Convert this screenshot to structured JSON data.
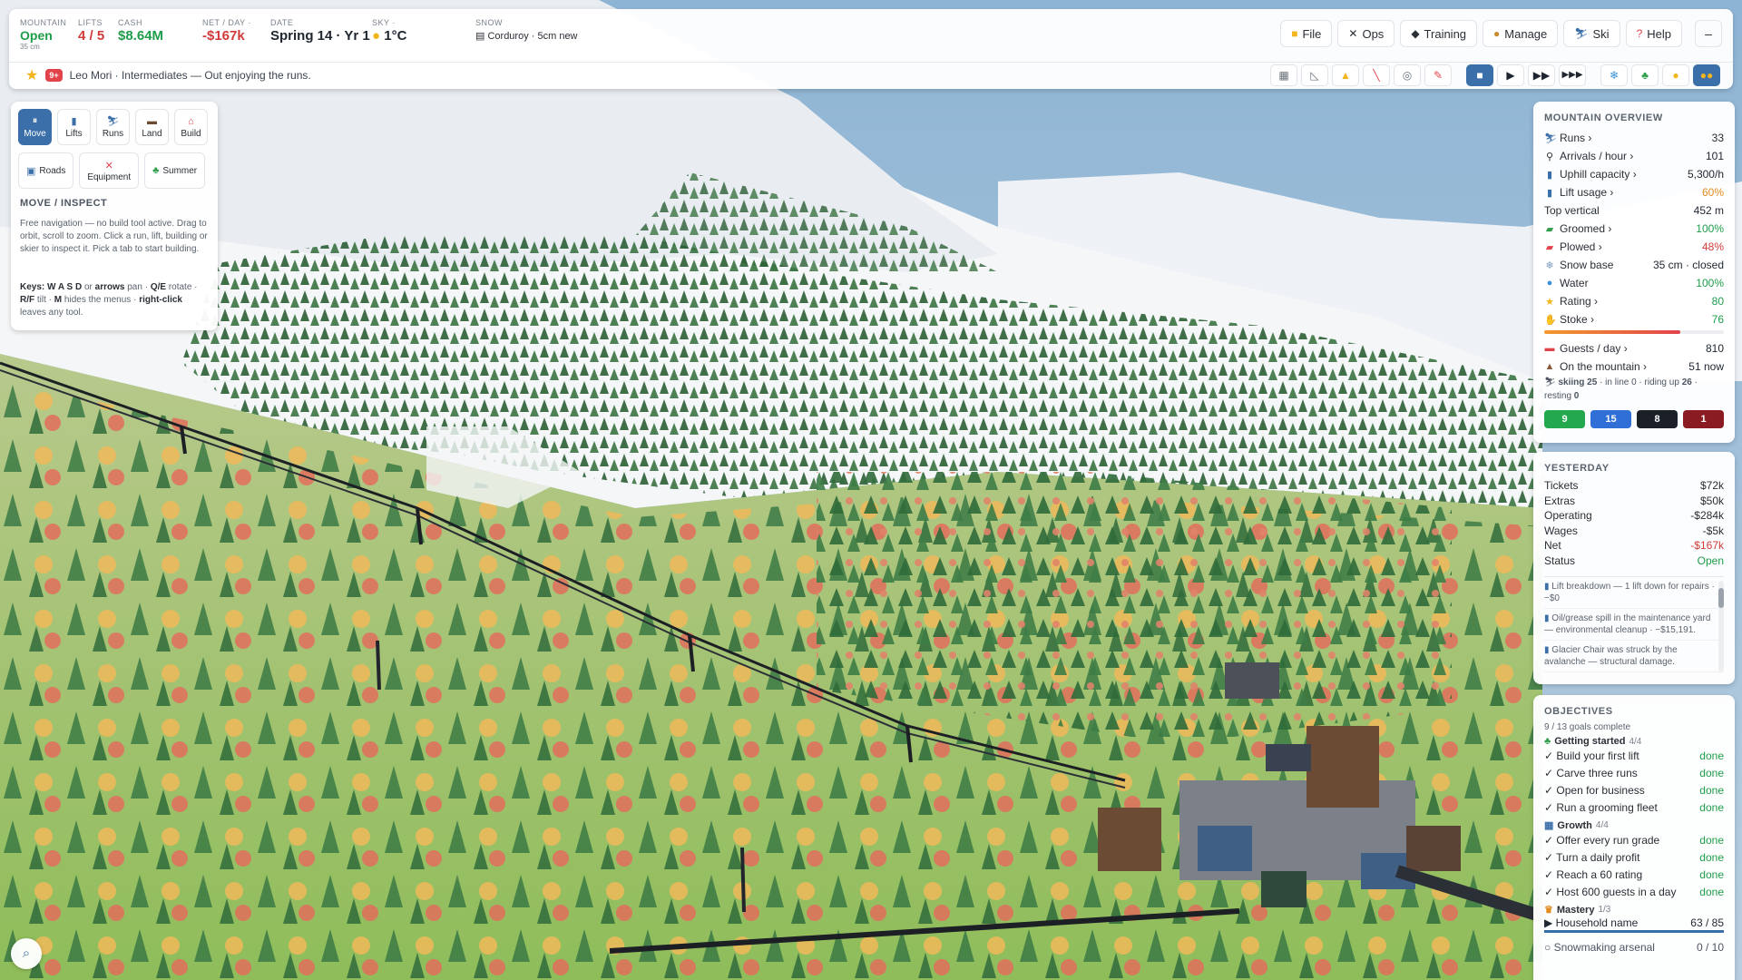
{
  "colors": {
    "accent": "#3b6fa9",
    "good": "#1e9d4a",
    "bad": "#d13a3a",
    "warn": "#e08a1e"
  },
  "topbar": {
    "mountain": {
      "label": "MOUNTAIN",
      "value": "Open",
      "sub": "35 cm"
    },
    "lifts": {
      "label": "LIFTS",
      "value": "4 / 5"
    },
    "cash": {
      "label": "CASH",
      "value": "$8.64M"
    },
    "net": {
      "label": "NET / DAY ·",
      "value": "-$167k"
    },
    "date": {
      "label": "DATE",
      "value": "Spring 14 · Yr 1"
    },
    "sky": {
      "label": "SKY ·",
      "icon": "sun-icon",
      "value": "1°C"
    },
    "snow": {
      "label": "SNOW",
      "value": "Corduroy · 5cm new"
    },
    "menu": [
      {
        "label": "File",
        "icon": "folder-icon"
      },
      {
        "label": "Ops",
        "icon": "tools-icon"
      },
      {
        "label": "Training",
        "icon": "graduation-icon"
      },
      {
        "label": "Manage",
        "icon": "money-bag-icon"
      },
      {
        "label": "Ski",
        "icon": "skier-icon"
      },
      {
        "label": "Help",
        "icon": "question-icon"
      }
    ],
    "minimize": "–",
    "ticker": {
      "badge": "9+",
      "text": "Leo Mori · Intermediates — Out enjoying the runs."
    },
    "overlay_tools": [
      "chart-icon",
      "slope-icon",
      "warning-icon",
      "ski-trail-icon",
      "target-icon",
      "paint-icon"
    ],
    "speed_controls": [
      "pause-icon",
      "play-icon",
      "fast-icon",
      "fastest-icon"
    ],
    "view_toggles": [
      "snowflake-icon",
      "summer-icon",
      "sun-icon",
      "sunset-icon"
    ]
  },
  "palette": {
    "tabs": [
      {
        "label": "Move",
        "icon": "move-icon",
        "active": true
      },
      {
        "label": "Lifts",
        "icon": "lift-icon"
      },
      {
        "label": "Runs",
        "icon": "run-icon"
      },
      {
        "label": "Land",
        "icon": "land-icon"
      },
      {
        "label": "Build",
        "icon": "building-icon"
      }
    ],
    "tabs2": [
      {
        "label": "Roads",
        "icon": "road-icon"
      },
      {
        "label": "Equipment",
        "icon": "wrench-icon"
      },
      {
        "label": "Summer",
        "icon": "tree-icon"
      }
    ],
    "title": "MOVE / INSPECT",
    "desc": "Free navigation — no build tool active. Drag to orbit, scroll to zoom. Click a run, lift, building or skier to inspect it. Pick a tab to start building.",
    "keys_prefix": "Keys:",
    "keys_k1": "W A S D",
    "keys_t1": "or",
    "keys_k2": "arrows",
    "keys_t2": "pan ·",
    "keys_k3": "Q/E",
    "keys_t3": "rotate ·",
    "keys_k4": "R/F",
    "keys_t4": "tilt ·",
    "keys_k5": "M",
    "keys_t5": "hides the menus ·",
    "keys_k6": "right-click",
    "keys_t6": "leaves any tool."
  },
  "overview": {
    "title": "MOUNTAIN OVERVIEW",
    "rows": [
      {
        "label": "Runs ›",
        "value": "33",
        "icon": "skier-icon",
        "tone": ""
      },
      {
        "label": "Arrivals / hour ›",
        "value": "101",
        "icon": "walker-icon",
        "tone": ""
      },
      {
        "label": "Uphill capacity ›",
        "value": "5,300/h",
        "icon": "lift-icon",
        "tone": ""
      },
      {
        "label": "Lift usage ›",
        "value": "60%",
        "icon": "lift-icon",
        "tone": "o"
      },
      {
        "label": "Top vertical",
        "value": "452 m",
        "icon": "",
        "tone": ""
      },
      {
        "label": "Groomed ›",
        "value": "100%",
        "icon": "groomer-icon",
        "tone": "g"
      },
      {
        "label": "Plowed ›",
        "value": "48%",
        "icon": "plow-icon",
        "tone": "r"
      },
      {
        "label": "Snow base",
        "value": "35 cm · closed",
        "icon": "snowflake-icon",
        "tone": ""
      },
      {
        "label": "Water",
        "value": "100%",
        "icon": "water-icon",
        "tone": "g"
      },
      {
        "label": "Rating ›",
        "value": "80",
        "icon": "star-icon",
        "tone": "g"
      },
      {
        "label": "Stoke ›",
        "value": "76",
        "icon": "hand-icon",
        "tone": "g"
      }
    ],
    "stoke_level": 0.76,
    "guests": {
      "label": "Guests / day ›",
      "value": "810",
      "icon": "ticket-icon"
    },
    "on_mountain": {
      "label": "On the mountain ›",
      "value": "51 now",
      "icon": "mountain-icon"
    },
    "breakdown": "skiing 25 · 🚶 in line 0 · 🚡 riding up 26 · 🏠 resting 0",
    "breakdown_b1": "skiing 25",
    "breakdown_t1": " · in line 0 · riding up",
    "breakdown_b2": "26",
    "breakdown_t2": " · resting ",
    "breakdown_b3": "0",
    "difficulty_counts": [
      {
        "value": "9",
        "color": "#23a84e"
      },
      {
        "value": "15",
        "color": "#2f6fd6"
      },
      {
        "value": "8",
        "color": "#1b1f27"
      },
      {
        "value": "1",
        "color": "#8a1b22"
      }
    ]
  },
  "yesterday": {
    "title": "YESTERDAY",
    "rows": [
      {
        "label": "Tickets",
        "value": "$72k",
        "tone": ""
      },
      {
        "label": "Extras",
        "value": "$50k",
        "tone": ""
      },
      {
        "label": "Operating",
        "value": "-$284k",
        "tone": ""
      },
      {
        "label": "Wages",
        "value": "-$5k",
        "tone": ""
      },
      {
        "label": "Net",
        "value": "-$167k",
        "tone": "r"
      },
      {
        "label": "Status",
        "value": "Open",
        "tone": "g"
      }
    ],
    "events": [
      "Lift breakdown — 1 lift down for repairs · −$0",
      "Oil/grease spill in the maintenance yard — environmental cleanup · −$15,191.",
      "Glacier Chair was struck by the avalanche — structural damage."
    ]
  },
  "objectives": {
    "title": "OBJECTIVES",
    "progress": "9 / 13 goals complete",
    "groups": [
      {
        "name": "Getting started",
        "count": "4/4",
        "icon": "leaf-icon",
        "items": [
          {
            "label": "✓ Build your first lift",
            "status": "done"
          },
          {
            "label": "✓ Carve three runs",
            "status": "done"
          },
          {
            "label": "✓ Open for business",
            "status": "done"
          },
          {
            "label": "✓ Run a grooming fleet",
            "status": "done"
          }
        ]
      },
      {
        "name": "Growth",
        "count": "4/4",
        "icon": "chart-icon",
        "items": [
          {
            "label": "✓ Offer every run grade",
            "status": "done"
          },
          {
            "label": "✓ Turn a daily profit",
            "status": "done"
          },
          {
            "label": "✓ Reach a 60 rating",
            "status": "done"
          },
          {
            "label": "✓ Host 600 guests in a day",
            "status": "done"
          }
        ]
      },
      {
        "name": "Mastery",
        "count": "1/3",
        "icon": "trophy-icon",
        "items": [
          {
            "label": "▶ Household name",
            "status": "63 / 85"
          },
          {
            "label": "○ Snowmaking arsenal",
            "status": "0 / 10"
          }
        ]
      }
    ]
  }
}
